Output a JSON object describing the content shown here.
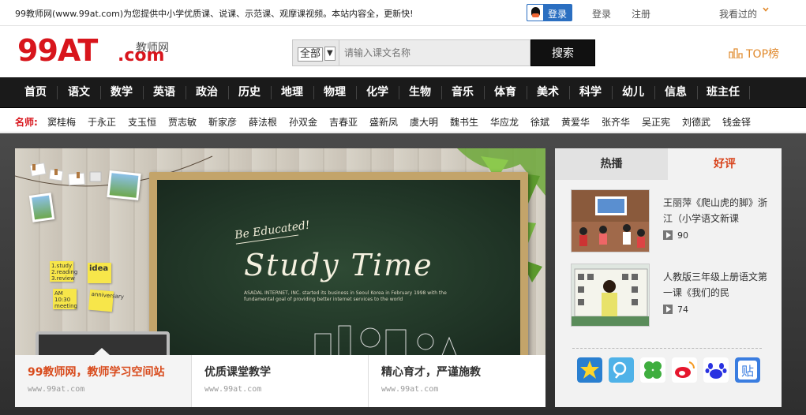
{
  "topbar": {
    "notice": "99教师网(www.99at.com)为您提供中小学优质课、说课、示范课、观摩课视频。本站内容全，更新快!",
    "qq_login": "登录",
    "login": "登录",
    "register": "注册",
    "history": "我看过的"
  },
  "header": {
    "logo_main": "99AT",
    "logo_dot": ".com",
    "logo_sub": "教师网",
    "search_select": "全部",
    "search_placeholder": "请输入课文名称",
    "search_button": "搜索",
    "top_list": "TOP榜"
  },
  "nav": {
    "items": [
      "首页",
      "语文",
      "数学",
      "英语",
      "政治",
      "历史",
      "地理",
      "物理",
      "化学",
      "生物",
      "音乐",
      "体育",
      "美术",
      "科学",
      "幼儿",
      "信息",
      "班主任"
    ]
  },
  "teachers": {
    "label": "名师:",
    "names": [
      "窦桂梅",
      "于永正",
      "支玉恒",
      "贾志敏",
      "靳家彦",
      "薛法根",
      "孙双金",
      "吉春亚",
      "盛新凤",
      "虞大明",
      "魏书生",
      "华应龙",
      "徐斌",
      "黄爱华",
      "张齐华",
      "吴正宪",
      "刘德武",
      "钱金铎"
    ]
  },
  "banner": {
    "be_educated": "Be Educated!",
    "study_time": "Study Time",
    "fine_print": "ASADAL INTERNET, INC. started its business in Seoul Korea in February 1998 with the fundamental goal of providing better internet services to the world",
    "notes": [
      "1.study 2.reading 3.review",
      "idea",
      "AM 10:30 meeting",
      "anniversary"
    ],
    "tabs": [
      {
        "title": "99教师网，教师学习空间站",
        "url": "www.99at.com"
      },
      {
        "title": "优质课堂教学",
        "url": "www.99at.com"
      },
      {
        "title": "精心育才，严谨施教",
        "url": "www.99at.com"
      }
    ]
  },
  "side": {
    "tab_hot": "热播",
    "tab_good": "好评",
    "videos": [
      {
        "title": "王丽萍《爬山虎的脚》浙江（小学语文新课",
        "count": "90"
      },
      {
        "title": "人教版三年级上册语文第一课《我们的民",
        "count": "74"
      }
    ],
    "share_icons": [
      "qzone-icon",
      "tencent-weibo-icon",
      "clover-icon",
      "sina-weibo-icon",
      "baidu-icon",
      "tieba-icon"
    ]
  },
  "colors": {
    "brand_red": "#d8151c",
    "nav_bg": "#1a1a1a",
    "accent_orange": "#d8431b",
    "top_list_orange": "#e0882a"
  }
}
